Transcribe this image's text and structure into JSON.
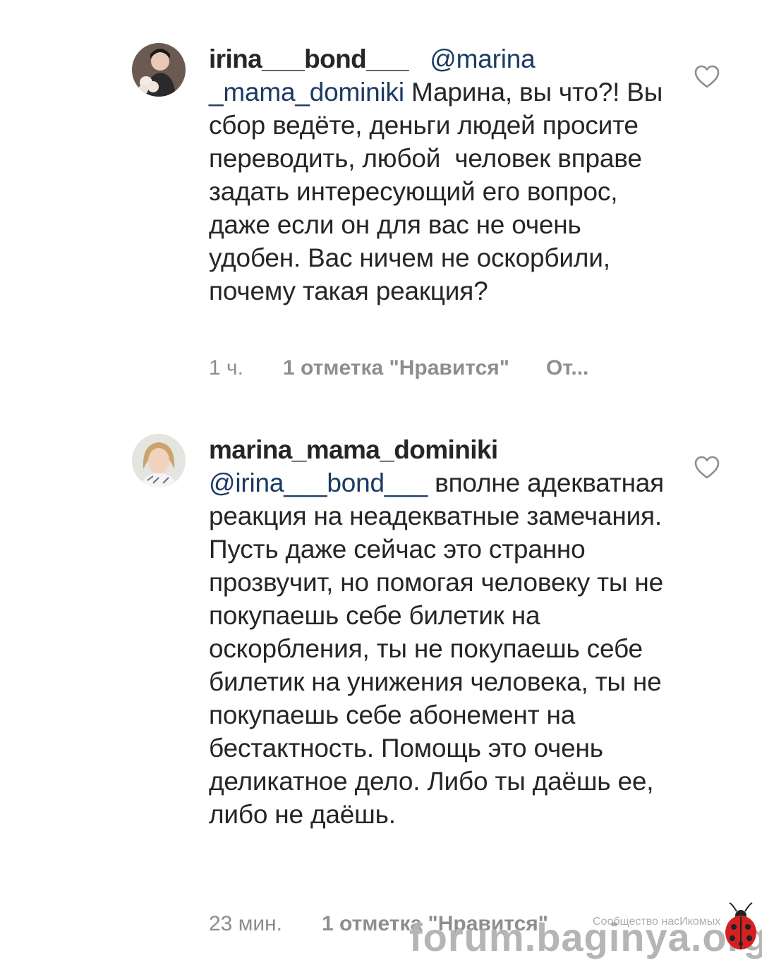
{
  "comments": [
    {
      "username": "irina___bond___",
      "mention": "@marina _mama_dominiki",
      "text": " Марина, вы что?! Вы сбор ведёте, деньги людей просите переводить, любой  человек вправе задать интересующий его вопрос, даже если он для вас не очень удобен. Вас ничем не оскорбили, почему такая реакция?",
      "time": "1 ч.",
      "likes": "1 отметка \"Нравится\"",
      "reply": "От..."
    },
    {
      "username": "marina_mama_dominiki",
      "mention": "@irina___bond___",
      "text": " вполне адекватная реакция на неадекватные замечания. Пусть даже сейчас это странно прозвучит, но помогая человеку ты не покупаешь себе билетик на оскорбления, ты не покупаешь себе билетик на унижения человека, ты не покупаешь себе абонемент на бестактность. Помощь это очень деликатное дело. Либо ты даёшь ее, либо не даёшь.",
      "time": "23 мин.",
      "likes": "1 отметка \"Нравится\""
    }
  ],
  "watermark": {
    "main": "forum.baginya.org",
    "sub": "Сообщество насИкомых"
  },
  "icons": [
    "heart-icon",
    "avatar",
    "ladybug-icon"
  ],
  "colors": {
    "text": "#262626",
    "mention": "#1b3a63",
    "meta": "#8e8e8e"
  }
}
